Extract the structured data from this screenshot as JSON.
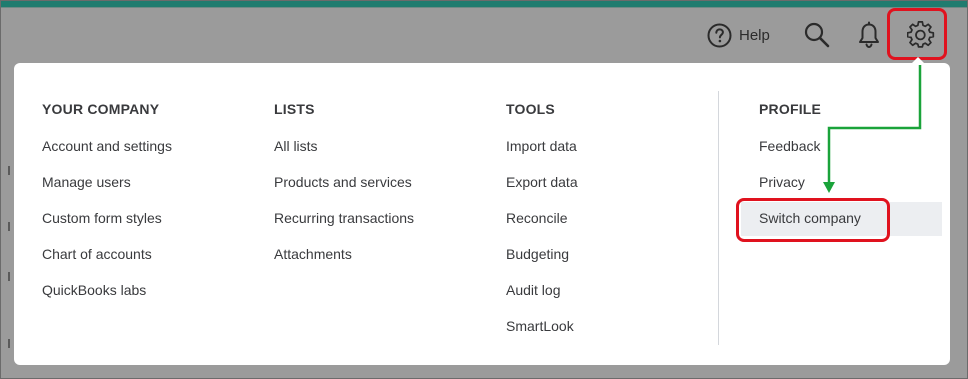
{
  "header": {
    "help_label": "Help",
    "icons": [
      "help-circle-icon",
      "search-icon",
      "bell-icon",
      "gear-icon"
    ]
  },
  "menu": {
    "columns": [
      {
        "title": "YOUR COMPANY",
        "items": [
          "Account and settings",
          "Manage users",
          "Custom form styles",
          "Chart of accounts",
          "QuickBooks labs"
        ]
      },
      {
        "title": "LISTS",
        "items": [
          "All lists",
          "Products and services",
          "Recurring transactions",
          "Attachments"
        ]
      },
      {
        "title": "TOOLS",
        "items": [
          "Import data",
          "Export data",
          "Reconcile",
          "Budgeting",
          "Audit log",
          "SmartLook"
        ]
      },
      {
        "title": "PROFILE",
        "items": [
          "Feedback",
          "Privacy",
          "Switch company"
        ]
      }
    ]
  },
  "colors": {
    "accent": "#1f7c6f",
    "overlay": "#9b9b9b",
    "highlight": "#e0121e",
    "arrow": "#1aa33a",
    "text": "#393a3d",
    "hover": "#eceef1"
  }
}
